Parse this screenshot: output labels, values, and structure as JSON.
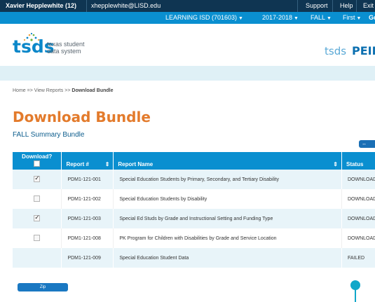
{
  "topbar": {
    "user": "Xavier Hepplewhite (12)",
    "email": "xhepplewhite@LISD.edu",
    "support": "Support",
    "help": "Help",
    "exit": "Exit"
  },
  "subbar": {
    "district": "LEARNING ISD (701603)",
    "year": "2017-2018",
    "submission": "FALL",
    "first": "First",
    "go": "Go"
  },
  "logo": {
    "word": "tsds",
    "tagline_1": "texas student",
    "tagline_2": "data system",
    "right_word_1": "tsds",
    "right_word_2": "PEIMS"
  },
  "breadcrumb": {
    "home": "Home",
    "arrow1": "=>",
    "view_reports": "View Reports",
    "arrow2": ">>",
    "current": "Download Bundle"
  },
  "page": {
    "title": "Download Bundle",
    "subtitle": "FALL Summary Bundle",
    "collapse_label": "↔"
  },
  "table": {
    "headers": {
      "download": "Download?",
      "report_no": "Report #",
      "report_name": "Report Name",
      "status": "Status"
    },
    "rows": [
      {
        "checked": true,
        "report_no": "PDM1-121-001",
        "name": "Special Education Students by Primary, Secondary, and Tertiary Disability",
        "status": "DOWNLOAD"
      },
      {
        "checked": false,
        "report_no": "PDM1-121-002",
        "name": "Special Education Students by Disability",
        "status": "DOWNLOAD"
      },
      {
        "checked": true,
        "report_no": "PDM1-121-003",
        "name": "Special Ed Studs by Grade and Instructional Setting and Funding Type",
        "status": "DOWNLOAD"
      },
      {
        "checked": false,
        "report_no": "PDM1-121-008",
        "name": "PK Program for Children with Disabilities by Grade and Service Location",
        "status": "DOWNLOAD"
      },
      {
        "checked": null,
        "report_no": "PDM1-121-009",
        "name": "Special Education Student Data",
        "status": "FAILED"
      }
    ]
  },
  "footer": {
    "zip_label": "Zip"
  },
  "colors": {
    "navy": "#0f3552",
    "blue": "#0a8fd0",
    "orange": "#e37b2c",
    "row_tint": "#e8f4f9"
  }
}
